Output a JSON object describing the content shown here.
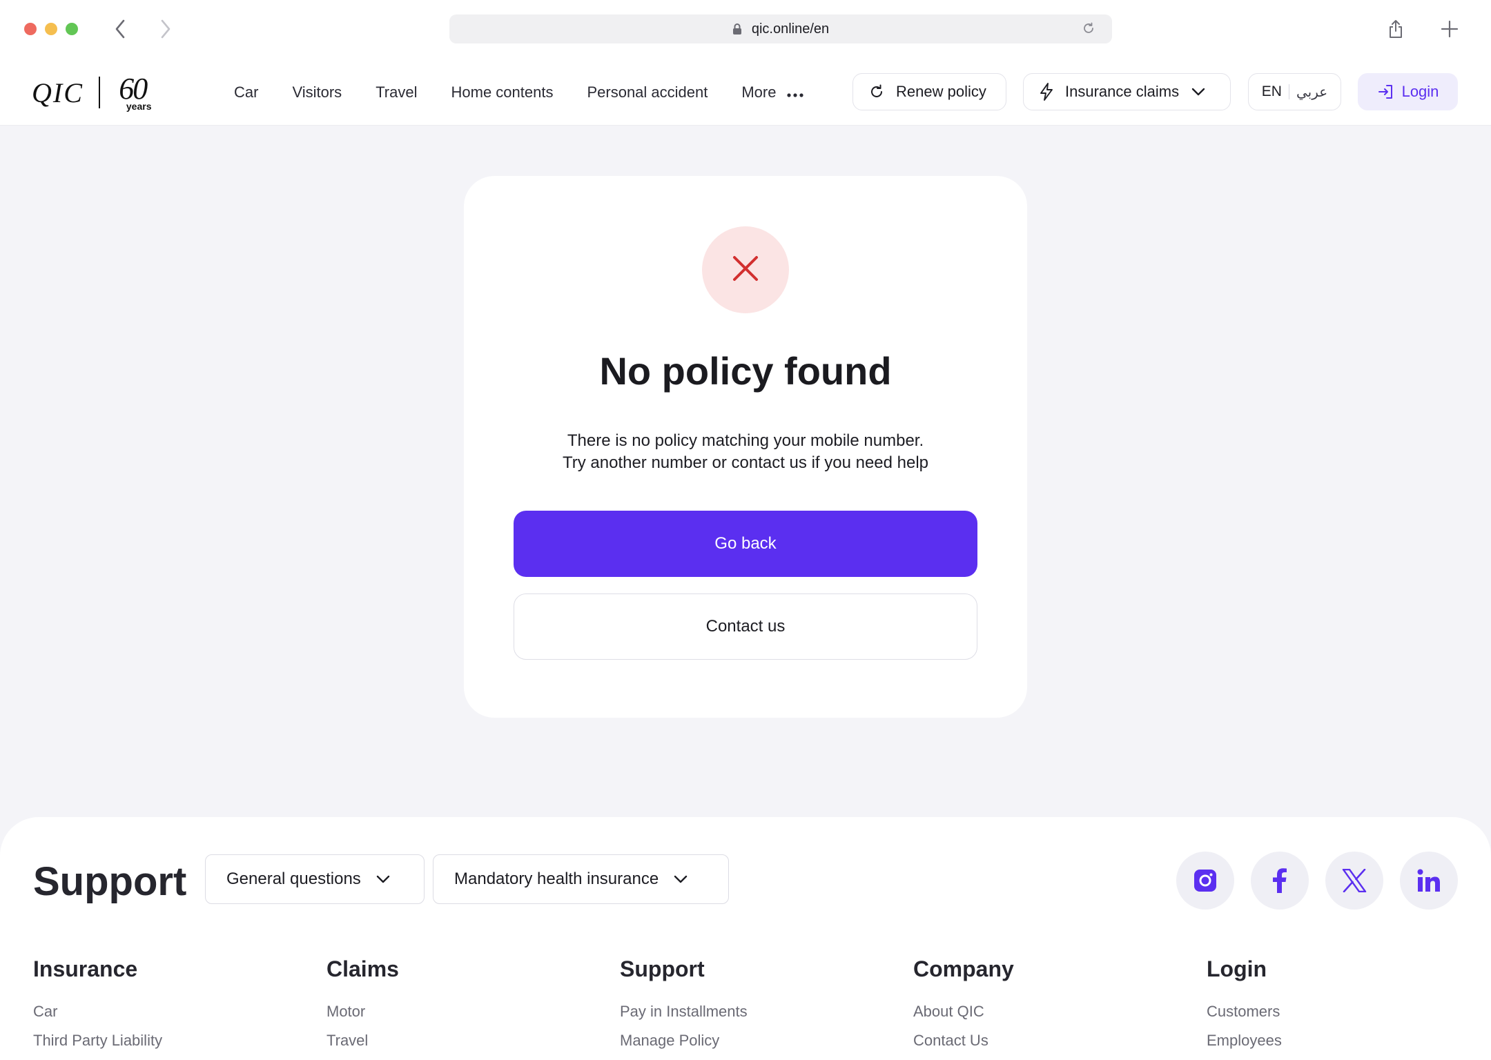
{
  "browser": {
    "url": "qic.online/en"
  },
  "header": {
    "logo_brand": "QIC",
    "logo_anniversary_number": "60",
    "logo_anniversary_word": "years",
    "nav": [
      "Car",
      "Visitors",
      "Travel",
      "Home contents",
      "Personal accident"
    ],
    "more_label": "More",
    "renew_label": "Renew policy",
    "claims_label": "Insurance claims",
    "lang_en": "EN",
    "lang_ar": "عربي",
    "login_label": "Login"
  },
  "card": {
    "title": "No policy found",
    "message_line1": "There is no policy matching your mobile number.",
    "message_line2": "Try another number or contact us if you need help",
    "primary_button": "Go back",
    "secondary_button": "Contact us"
  },
  "footer": {
    "support_title": "Support",
    "dropdowns": [
      "General questions",
      "Mandatory health insurance"
    ],
    "social_icons": [
      "instagram-icon",
      "facebook-icon",
      "x-icon",
      "linkedin-icon"
    ],
    "columns": [
      {
        "heading": "Insurance",
        "links": [
          "Car",
          "Third Party Liability"
        ]
      },
      {
        "heading": "Claims",
        "links": [
          "Motor",
          "Travel"
        ]
      },
      {
        "heading": "Support",
        "links": [
          "Pay in Installments",
          "Manage Policy"
        ]
      },
      {
        "heading": "Company",
        "links": [
          "About QIC",
          "Contact Us"
        ]
      },
      {
        "heading": "Login",
        "links": [
          "Customers",
          "Employees"
        ]
      }
    ]
  },
  "colors": {
    "accent": "#5b2ff0",
    "error": "#d22f2f",
    "error_bg": "#fbe4e4",
    "page_bg": "#f4f4f8"
  }
}
